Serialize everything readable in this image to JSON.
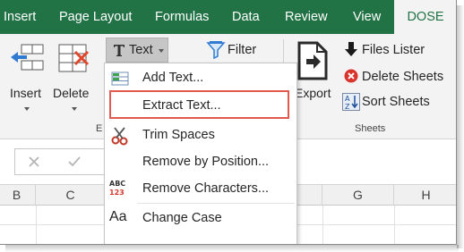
{
  "tabs": [
    {
      "label": "Insert"
    },
    {
      "label": "Page Layout"
    },
    {
      "label": "Formulas"
    },
    {
      "label": "Data"
    },
    {
      "label": "Review"
    },
    {
      "label": "View"
    },
    {
      "label": "DOSE"
    }
  ],
  "ribbon": {
    "insert_label": "Insert",
    "delete_label": "Delete",
    "text_label": "Text",
    "filter_label": "Filter",
    "export_label": "Export",
    "files_lister_label": "Files Lister",
    "delete_sheets_label": "Delete Sheets",
    "sort_sheets_label": "Sort Sheets",
    "sheets_group_label": "Sheets",
    "partial_group_label": "E"
  },
  "text_menu": {
    "items": [
      {
        "label": "Add Text...",
        "icon": "add-text-icon"
      },
      {
        "label": "Extract Text...",
        "icon": "extract-text-icon"
      },
      {
        "label": "Trim Spaces",
        "icon": "scissors-icon"
      },
      {
        "label": "Remove by Position...",
        "icon": "none"
      },
      {
        "label": "Remove Characters...",
        "icon": "abc-123-icon"
      },
      {
        "label": "Change Case",
        "icon": "aa-icon"
      }
    ],
    "icon_abc": "ABC",
    "icon_123": "123",
    "icon_aa": "Aa"
  },
  "columns": [
    "B",
    "C",
    "G",
    "H"
  ],
  "colors": {
    "accent": "#217346",
    "highlight_border": "#e05a52"
  }
}
